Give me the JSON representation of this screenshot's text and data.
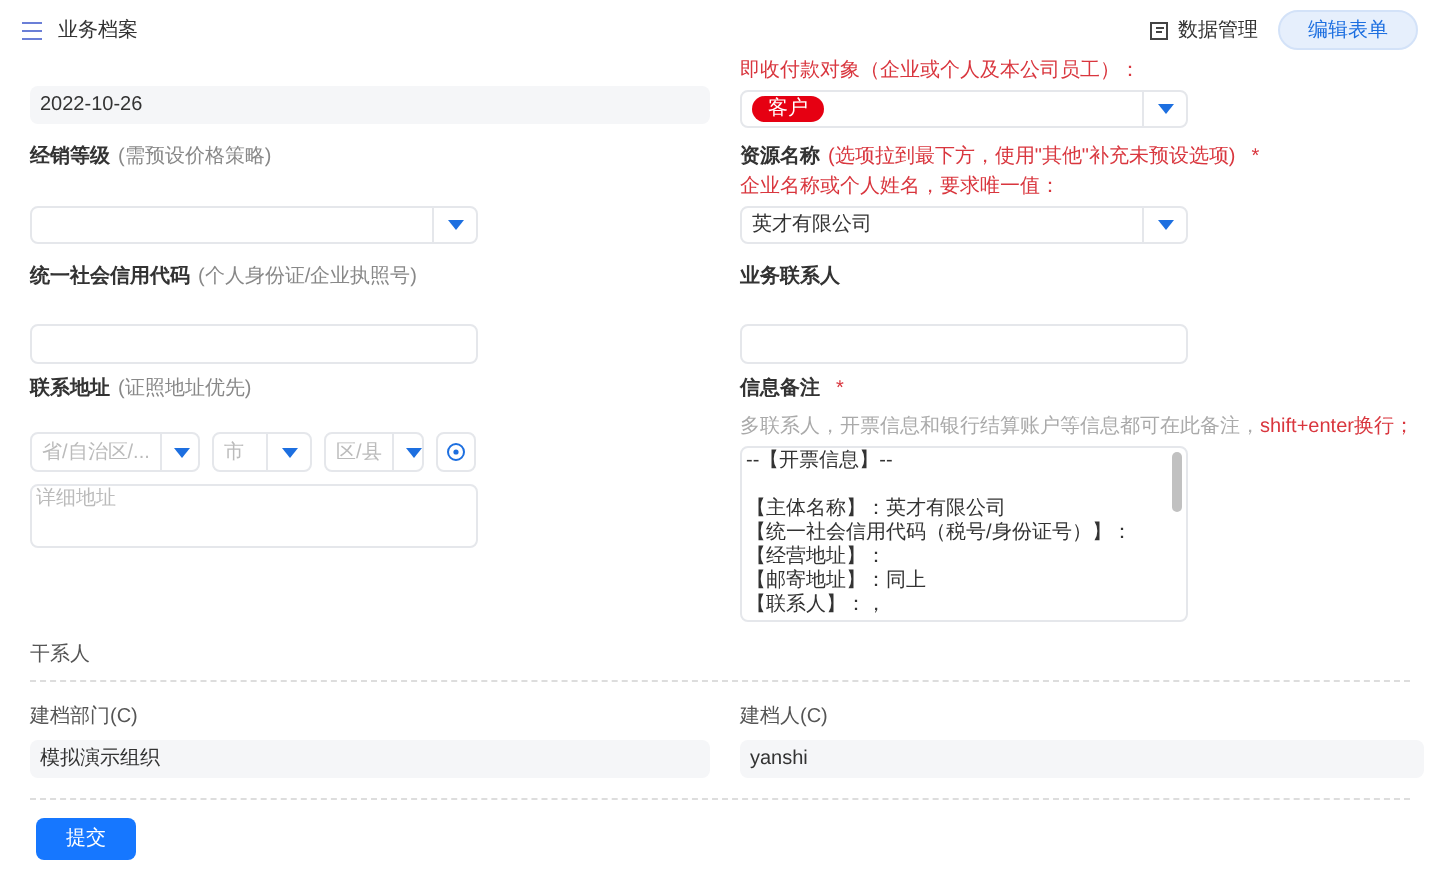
{
  "header": {
    "title": "业务档案",
    "data_button": "数据管理",
    "edit_button": "编辑表单"
  },
  "rows": [
    {
      "left": {
        "kind": "readonly",
        "value": "2022-10-26"
      },
      "right": {
        "kind": "tagselect",
        "sublabel": "即收付款对象（企业或个人及本公司员工）：",
        "tags": [
          {
            "label": "客户",
            "color": "#e60012"
          }
        ]
      }
    },
    {
      "left": {
        "kind": "select",
        "label": "经销等级",
        "hint": "(需预设价格策略)",
        "hint_warning": false
      },
      "right": {
        "kind": "select",
        "label": "资源名称",
        "hint": "(选项拉到最下方，使用\"其他\"补充未预设选项)",
        "hint_warning": true,
        "required_mark": "*",
        "sublabel": "企业名称或个人姓名，要求唯一值：",
        "value": "英才有限公司"
      }
    },
    {
      "left": {
        "kind": "input",
        "label": "统一社会信用代码",
        "hint": "(个人身份证/企业执照号)",
        "hint_warning": false
      },
      "right": {
        "kind": "input",
        "label": "业务联系人"
      }
    },
    {
      "left": {
        "kind": "address",
        "label": "联系地址",
        "hint": "(证照地址优先)",
        "hint_warning": false,
        "selects": [
          "省/自治区/...",
          "市",
          "区/县"
        ],
        "detail_placeholder": "详细地址"
      },
      "right": {
        "kind": "textarea",
        "label": "信息备注",
        "required_mark": "*",
        "sublabel": "多联系人，开票信息和银行结算账户等信息都可在此备注，",
        "sublabel_accent": "shift+enter换行；",
        "paragraphs": [
          [
            "--【开票信息】--"
          ],
          [
            "【主体名称】：英才有限公司",
            "【统一社会信用代码（税号/身份证号）】：",
            "【经营地址】：",
            "【邮寄地址】：同上",
            "【联系人】：，"
          ]
        ]
      }
    }
  ],
  "section": {
    "title": "干系人",
    "fields": [
      {
        "label": "建档部门(C)",
        "value": "模拟演示组织"
      },
      {
        "label": "建档人(C)",
        "value": "yanshi"
      }
    ]
  },
  "submit_button": "提交"
}
